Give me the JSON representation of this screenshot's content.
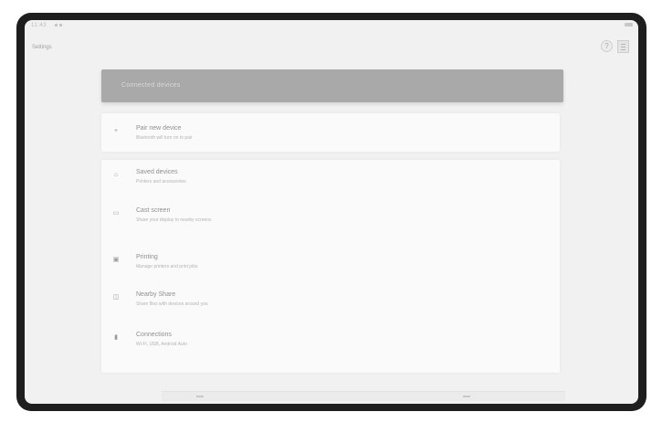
{
  "status_bar": {
    "time": "11:43"
  },
  "header": {
    "back_label": "Settings"
  },
  "banner": {
    "title": "Connected devices"
  },
  "top_card": {
    "title": "Pair new device",
    "subtitle": "Bluetooth will turn on to pair"
  },
  "list": [
    {
      "icon": "bluetooth-icon",
      "glyph": "⌂",
      "title": "Saved devices",
      "subtitle": "Printers and accessories"
    },
    {
      "icon": "cast-icon",
      "glyph": "▭",
      "title": "Cast screen",
      "subtitle": "Share your display to nearby screens"
    },
    {
      "icon": "print-icon",
      "glyph": "▣",
      "title": "Printing",
      "subtitle": "Manage printers and print jobs"
    },
    {
      "icon": "nearby-share-icon",
      "glyph": "◫",
      "title": "Nearby Share",
      "subtitle": "Share files with devices around you"
    },
    {
      "icon": "phone-icon",
      "glyph": "▮",
      "title": "Connections",
      "subtitle": "Wi-Fi, USB, Android Auto"
    }
  ]
}
